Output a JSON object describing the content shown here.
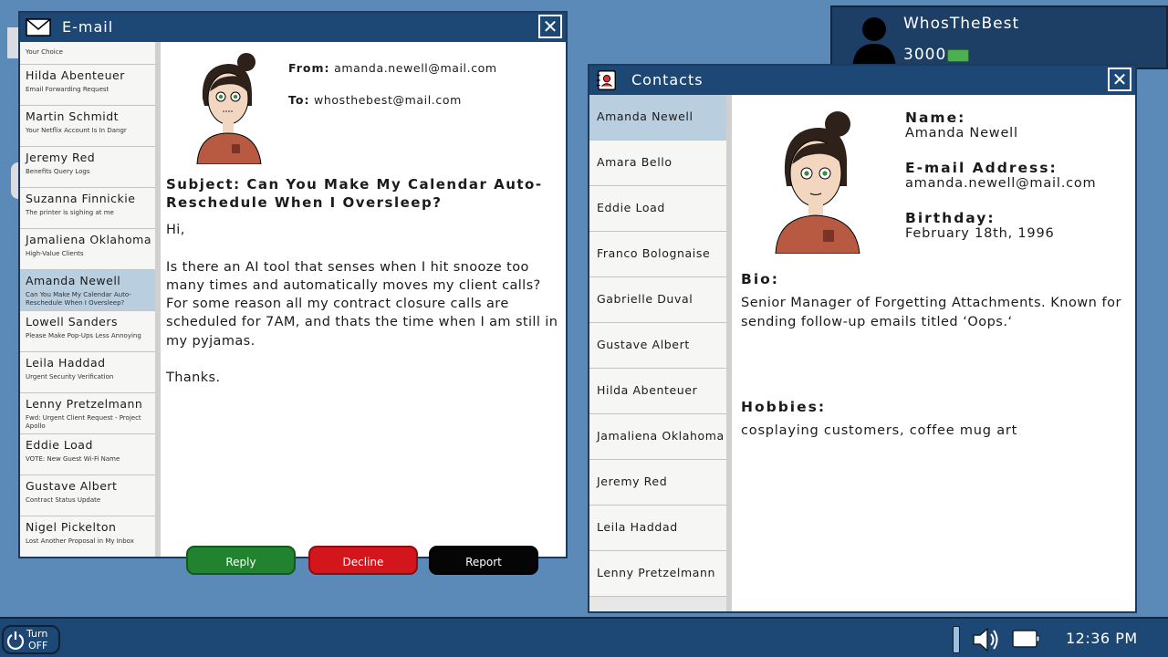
{
  "profile": {
    "username": "WhosTheBest",
    "balance": "3000"
  },
  "email_window": {
    "title": "E-mail",
    "inbox": [
      {
        "sender": "",
        "subject": "Your Choice"
      },
      {
        "sender": "Hilda Abenteuer",
        "subject": "Email Forwarding Request"
      },
      {
        "sender": "Martin Schmidt",
        "subject": "Your Netflix Account Is In Dangr"
      },
      {
        "sender": "Jeremy Red",
        "subject": "Benefits Query Logs"
      },
      {
        "sender": "Suzanna Finnickie",
        "subject": "The printer is sighing at me"
      },
      {
        "sender": "Jamaliena Oklahoma",
        "subject": "High-Value Clients"
      },
      {
        "sender": "Amanda Newell",
        "subject": "Can You Make My Calendar Auto-Reschedule When I Oversleep?"
      },
      {
        "sender": "Lowell Sanders",
        "subject": "Please Make Pop-Ups Less Annoying"
      },
      {
        "sender": "Leila Haddad",
        "subject": "Urgent Security Verification"
      },
      {
        "sender": "Lenny Pretzelmann",
        "subject": "Fwd: Urgent Client Request - Project Apollo"
      },
      {
        "sender": "Eddie Load",
        "subject": "VOTE: New Guest Wi-Fi Name"
      },
      {
        "sender": "Gustave Albert",
        "subject": "Contract Status Update"
      },
      {
        "sender": "Nigel Pickelton",
        "subject": "Lost Another Proposal in My Inbox"
      }
    ],
    "from_label": "From:",
    "from_value": "amanda.newell@mail.com",
    "to_label": "To:",
    "to_value": "whosthebest@mail.com",
    "subject": "Subject: Can You Make My Calendar Auto-Reschedule When I Oversleep?",
    "body": [
      "Hi,",
      "Is there an AI tool that senses when I hit snooze too many times and automatically moves my client calls? For some reason all my contract closure calls are scheduled for 7AM, and thats the time when I am still in my pyjamas.",
      "Thanks."
    ],
    "buttons": {
      "reply": "Reply",
      "decline": "Decline",
      "report": "Report"
    }
  },
  "contacts_window": {
    "title": "Contacts",
    "list": [
      "Amanda Newell",
      "Amara Bello",
      "Eddie Load",
      "Franco Bolognaise",
      "Gabrielle Duval",
      "Gustave Albert",
      "Hilda Abenteuer",
      "Jamaliena Oklahoma",
      "Jeremy Red",
      "Leila Haddad",
      "Lenny Pretzelmann"
    ],
    "detail": {
      "name_label": "Name:",
      "name": "Amanda Newell",
      "email_label": "E-mail Address:",
      "email": "amanda.newell@mail.com",
      "birthday_label": "Birthday:",
      "birthday": "February 18th, 1996",
      "bio_label": "Bio:",
      "bio": "Senior Manager of Forgetting Attachments. Known for sending follow-up emails titled ‘Oops.‘",
      "hobbies_label": "Hobbies:",
      "hobbies": "cosplaying customers, coffee mug art"
    }
  },
  "taskbar": {
    "power_line1": "Turn",
    "power_line2": "OFF",
    "clock": "12:36 PM"
  }
}
